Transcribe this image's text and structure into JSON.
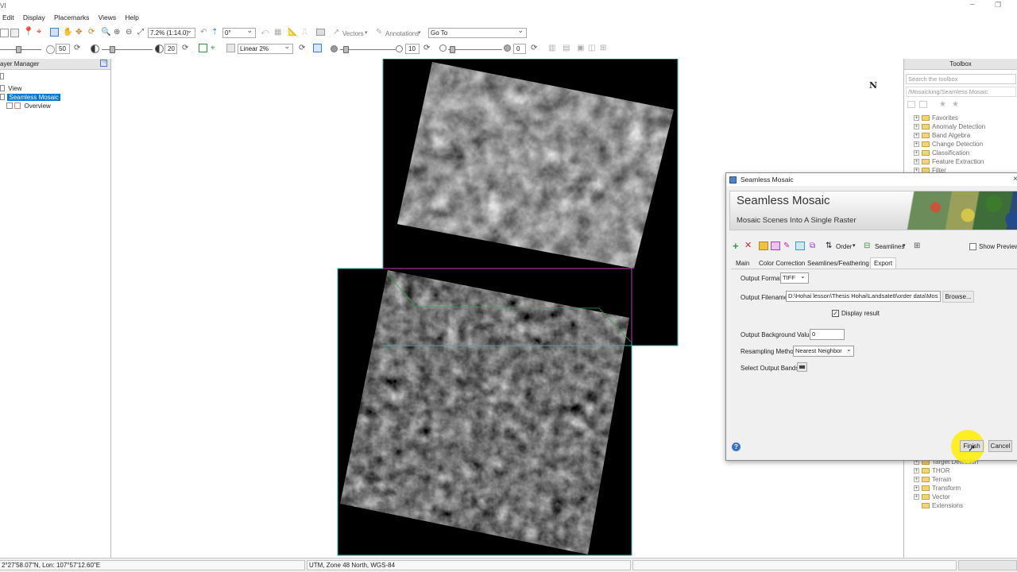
{
  "window": {
    "title": "VI"
  },
  "menu": [
    "Edit",
    "Display",
    "Placemarks",
    "Views",
    "Help"
  ],
  "toolbar1": {
    "zoom": "7.2% (1:14.0)",
    "rotation": "0°",
    "vectors": "Vectors",
    "annotations": "Annotations",
    "goto": "Go To"
  },
  "toolbar2": {
    "brightness": "50",
    "contrast": "20",
    "stretch": "Linear 2%",
    "sharpen": "10",
    "transparency": "0"
  },
  "layer_manager": {
    "title": "ayer Manager",
    "items": [
      "View",
      "Seamless Mosaic",
      "Overview"
    ]
  },
  "toolbox": {
    "title": "Toolbox",
    "search_placeholder": "Search the toolbox",
    "path": "/Mosaicking/Seamless Mosaic",
    "folders_top": [
      "Favorites",
      "Anomaly Detection",
      "Band Algebra",
      "Change Detection",
      "Classification",
      "Feature Extraction",
      "Filter"
    ],
    "folders_bottom": [
      "Target Detection",
      "THOR",
      "Terrain",
      "Transform",
      "Vector",
      "Extensions"
    ]
  },
  "map": {
    "north_label": "N"
  },
  "dialog": {
    "window_title": "Seamless Mosaic",
    "banner_title": "Seamless Mosaic",
    "banner_subtitle": "Mosaic Scenes Into A Single Raster",
    "order_label": "Order",
    "seamlines_label": "Seamlines",
    "show_preview": "Show Preview",
    "tabs": [
      "Main",
      "Color Correction",
      "Seamlines/Feathering",
      "Export"
    ],
    "active_tab": "Export",
    "output_format_label": "Output Format",
    "output_format": "TIFF",
    "output_filename_label": "Output Filename",
    "output_filename": "D:\\Hohai lesson\\Thesis Hohai\\Landsate8\\order data\\Mos",
    "browse": "Browse...",
    "display_result": "Display result",
    "bg_value_label": "Output Background Value",
    "bg_value": "0",
    "resampling_label": "Resampling Method",
    "resampling": "Nearest Neighbor",
    "bands_label": "Select Output Bands",
    "finish": "Finish",
    "cancel": "Cancel"
  },
  "status": {
    "coords": "2°27'58.07\"N, Lon: 107°57'12.60\"E",
    "projection": "UTM, Zone 48 North, WGS-84"
  }
}
